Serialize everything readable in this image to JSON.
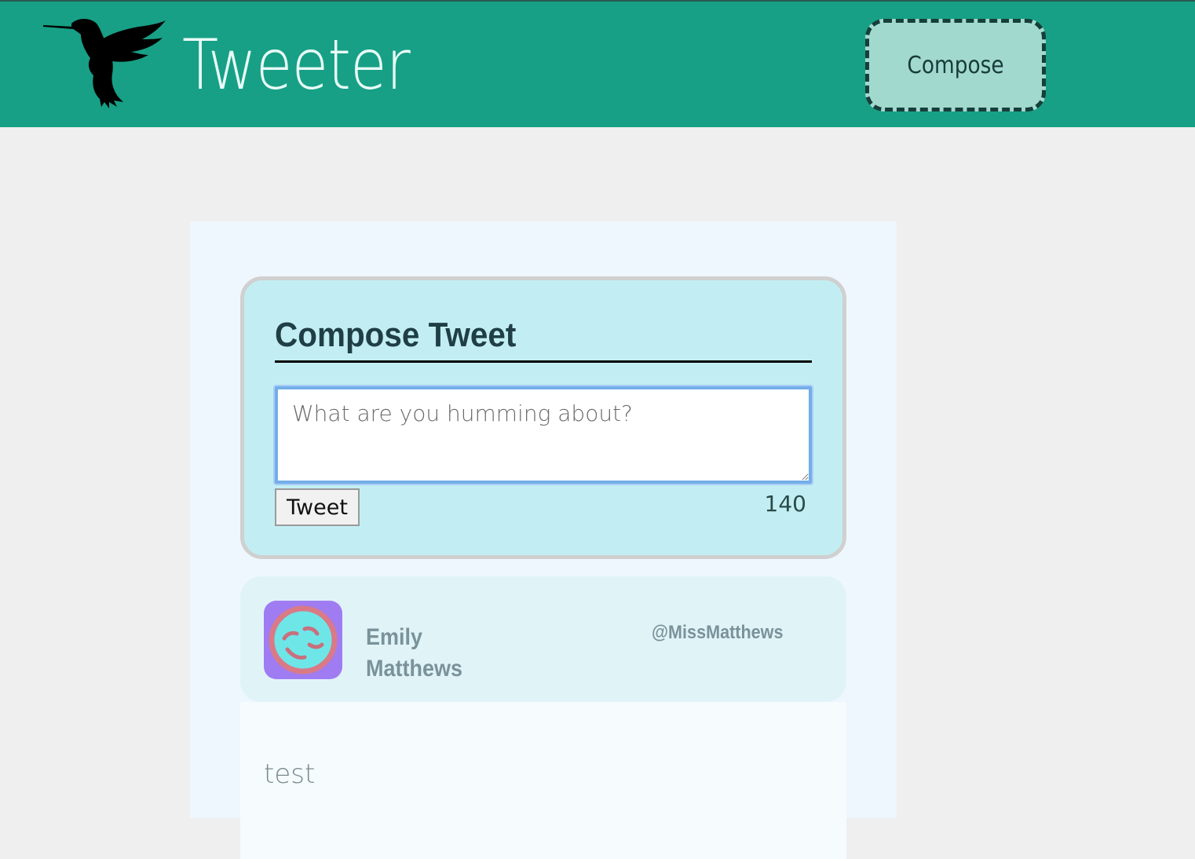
{
  "nav": {
    "brand": "Tweeter",
    "logo_icon": "hummingbird-icon",
    "compose_label": "Compose"
  },
  "compose": {
    "title": "Compose Tweet",
    "placeholder": "What are you humming about?",
    "value": "",
    "button_label": "Tweet",
    "counter": "140"
  },
  "tweets": [
    {
      "name_first": "Emily",
      "name_last": "Matthews",
      "handle": "@MissMatthews",
      "avatar_icon": "smiley-face-icon",
      "text": "test"
    }
  ],
  "colors": {
    "header_bg": "#17a086",
    "page_bg": "#efefef",
    "compose_bg": "#c2eef3",
    "compose_nav_bg": "#a2d9cf",
    "avatar_bg": "#a07cf2",
    "tweet_header_bg": "#e0f4f8"
  }
}
